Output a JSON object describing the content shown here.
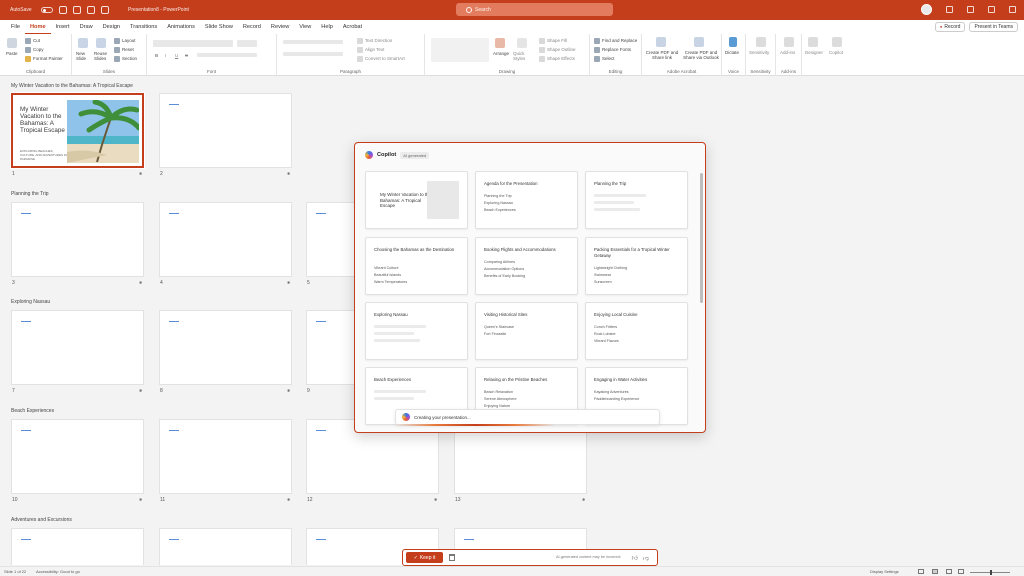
{
  "titlebar": {
    "autosave_label": "AutoSave",
    "doc_title": "Presentation8 - PowerPoint",
    "search_placeholder": "Search"
  },
  "menu": {
    "tabs": [
      "File",
      "Home",
      "Insert",
      "Draw",
      "Design",
      "Transitions",
      "Animations",
      "Slide Show",
      "Record",
      "Review",
      "View",
      "Help",
      "Acrobat"
    ],
    "active": "Home",
    "record_label": "Record",
    "present_label": "Present in Teams"
  },
  "ribbon": {
    "clipboard": {
      "label": "Clipboard",
      "paste": "Paste",
      "cut": "Cut",
      "copy": "Copy",
      "format_painter": "Format Painter"
    },
    "slides": {
      "label": "Slides",
      "new_slide": "New Slide",
      "reuse_slides": "Reuse Slides",
      "layout": "Layout",
      "reset": "Reset",
      "section": "Section"
    },
    "font": {
      "label": "Font",
      "bold": "B",
      "italic": "I",
      "underline": "U",
      "strike": "S"
    },
    "paragraph": {
      "label": "Paragraph",
      "text_direction": "Text Direction",
      "align_text": "Align Text",
      "convert_smartart": "Convert to SmartArt"
    },
    "drawing": {
      "label": "Drawing",
      "arrange": "Arrange",
      "quick_styles": "Quick Styles",
      "shape_fill": "Shape Fill",
      "shape_outline": "Shape Outline",
      "shape_effects": "Shape Effects"
    },
    "editing": {
      "label": "Editing",
      "find_replace": "Find and Replace",
      "replace_fonts": "Replace Fonts",
      "select": "Select"
    },
    "acrobat": {
      "label": "Adobe Acrobat",
      "create_pdf": "Create PDF and Share link",
      "create_outlook": "Create PDF and Share via Outlook"
    },
    "voice": {
      "label": "Voice",
      "dictate": "Dictate"
    },
    "sensitivity": {
      "label": "Sensitivity",
      "sensitivity": "Sensitivity"
    },
    "addins": {
      "label": "Add-ins",
      "addins": "Add-ins"
    },
    "designer": {
      "designer": "Designer",
      "copilot": "Copilot"
    }
  },
  "sections": [
    {
      "title": "My Winter Vacation to the Bahamas: A Tropical Escape"
    },
    {
      "title": "Planning the Trip"
    },
    {
      "title": "Exploring Nassau"
    },
    {
      "title": "Beach Experiences"
    },
    {
      "title": "Adventures and Excursions"
    }
  ],
  "slide1": {
    "title": "My Winter Vacation to the Bahamas: A Tropical Escape",
    "subtitle": "EXPLORING BEACHES, CULTURE, AND ADVENTURES IN PARADISE"
  },
  "slide_numbers": [
    "1",
    "2",
    "3",
    "4",
    "5",
    "7",
    "8",
    "9",
    "10",
    "11",
    "12",
    "13"
  ],
  "copilot": {
    "title": "Copilot",
    "badge": "AI generated",
    "progress_text": "Creating your presentation...",
    "cards": [
      {
        "title": "My Winter Vacation to the Bahamas: A Tropical Escape",
        "bullets": []
      },
      {
        "title": "Agenda for the Presentation",
        "bullets": [
          "Planning the Trip",
          "Exploring Nassau",
          "Beach Experiences"
        ]
      },
      {
        "title": "Planning the Trip",
        "bullets": []
      },
      {
        "title": "Choosing the Bahamas as the Destination",
        "bullets": [
          "Vibrant Culture",
          "Beautiful Islands",
          "Warm Temperatures"
        ]
      },
      {
        "title": "Booking Flights and Accommodations",
        "bullets": [
          "Comparing Airlines",
          "Accommodation Options",
          "Benefits of Early Booking"
        ]
      },
      {
        "title": "Packing Essentials for a Tropical Winter Getaway",
        "bullets": [
          "Lightweight Clothing",
          "Swimwear",
          "Sunscreen"
        ]
      },
      {
        "title": "Exploring Nassau",
        "bullets": []
      },
      {
        "title": "Visiting Historical Sites",
        "bullets": [
          "Queen's Staircase",
          "Fort Fincastle"
        ]
      },
      {
        "title": "Enjoying Local Cuisine",
        "bullets": [
          "Conch Fritters",
          "Rock Lobster",
          "Vibrant Flavors"
        ]
      },
      {
        "title": "Beach Experiences",
        "bullets": []
      },
      {
        "title": "Relaxing on the Pristine Beaches",
        "bullets": [
          "Beach Relaxation",
          "Serene Atmosphere",
          "Enjoying Nature"
        ]
      },
      {
        "title": "Engaging in Water Activities",
        "bullets": [
          "Kayaking Adventures",
          "Paddleboarding Experience"
        ]
      }
    ]
  },
  "keepbar": {
    "keep_label": "Keep it",
    "disclaimer": "AI-generated content may be incorrect"
  },
  "status": {
    "slide_of": "Slide 1 of 22",
    "accessibility": "Accessibility: Good to go",
    "display_settings": "Display Settings"
  }
}
